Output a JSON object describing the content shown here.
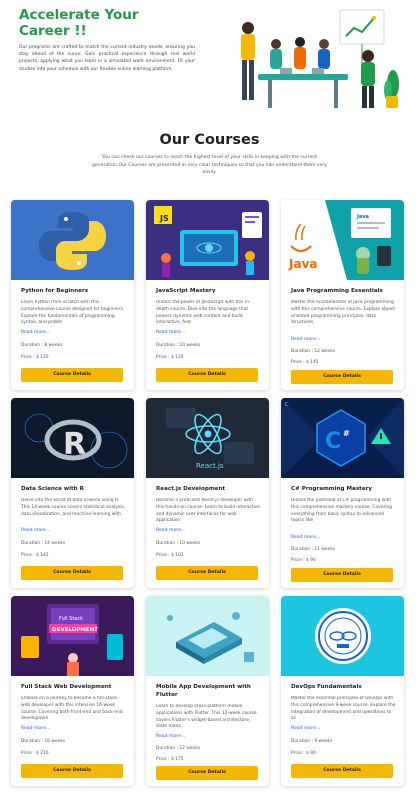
{
  "hero": {
    "title": "Accelerate Your Career !!",
    "text": "Our programs are crafted to match the current industry needs, ensuring you stay ahead of the curve. Gain practical experience through real world projects, applying what you learn in a simulated work environment. Fit your studies into your schedule with our flexible online learning platform."
  },
  "courses_section": {
    "title": "Our Courses",
    "subtitle": "You can check our courses to reach the highest level of your skills in keeping with the current generation.Our Courses are presented in very clear techniques so that you can understand them very easily."
  },
  "cards": [
    {
      "image_icon": "python-logo-icon",
      "title": "Python for Beginners",
      "description": "Learn Python from scratch with this comprehensive course designed for beginners. Explore the fundamentals of programming, syntax, and proble",
      "read_more": "Read more...",
      "duration": "Duration : 8 weeks",
      "price": "Price : $ 120",
      "button": "Course Details",
      "image_color": "#3a73c8"
    },
    {
      "image_icon": "javascript-illustration-icon",
      "title": "JavaScript Mastery",
      "description": "Unlock the power of JavaScript with this in-depth course. Dive into the language that powers dynamic web content and build interactive, feat",
      "read_more": "Read more...",
      "duration": "Duration : 10 weeks",
      "price": "Price : $ 120",
      "button": "Course Details",
      "image_color": "#3c2f82"
    },
    {
      "image_icon": "java-logo-icon",
      "title": "Java Programming Essentials",
      "description": "Master the fundamentals of Java programming with this comprehensive course. Explore object-oriented programming principles, data structures,",
      "read_more": "Read more...",
      "duration": "Duration : 12 weeks",
      "price": "Price : $ 145",
      "button": "Course Details",
      "image_color": "#0fa3a9"
    },
    {
      "image_icon": "r-logo-icon",
      "title": "Data Science with R",
      "description": "Delve into the world of data science using R. This 14-week course covers statistical analysis, data visualization, and machine learning with",
      "read_more": "Read more...",
      "duration": "Duration : 14 weeks",
      "price": "Price : $ 142",
      "button": "Course Details",
      "image_color": "#0c1a2c"
    },
    {
      "image_icon": "react-logo-icon",
      "title": "React.js Development",
      "description": "Become a proficient React.js developer with this hands-on course. Learn to build interactive and dynamic user interfaces for web application",
      "read_more": "Read more...",
      "duration": "Duration : 10 weeks",
      "price": "Price : $ 102",
      "button": "Course Details",
      "image_color": "#1f2a38"
    },
    {
      "image_icon": "csharp-logo-icon",
      "title": "C# Programming Mastery",
      "description": "Unlock the potential of C# programming with this comprehensive mastery course. Covering everything from basic syntax to advanced topics like",
      "read_more": "Read more...",
      "duration": "Duration : 11 weeks",
      "price": "Price : $ 90",
      "button": "Course Details",
      "image_color": "#0a1e4a"
    },
    {
      "image_icon": "fullstack-illustration-icon",
      "title": "Full Stack Web Development",
      "description": "Embark on a journey to become a full-stack web developer with this intensive 16-week course. Covering both front-end and back-end developmen",
      "read_more": "Read more...",
      "duration": "Duration : 16 weeks",
      "price": "Price : $ 210",
      "button": "Course Details",
      "image_color": "#3b1a5c"
    },
    {
      "image_icon": "mobile-app-illustration-icon",
      "title": "Mobile App Development with Flutter",
      "description": "Learn to develop cross-platform mobile applications with Flutter. This 12-week course covers Flutter's widget-based architecture, state mana",
      "read_more": "Read more...",
      "duration": "Duration : 12 weeks",
      "price": "Price : $ 175",
      "button": "Course Details",
      "image_color": "#c9f3f3"
    },
    {
      "image_icon": "devops-badge-icon",
      "title": "DevOps Fundamentals",
      "description": "Master the essential principles of DevOps with this comprehensive 9-week course. Explore the integration of development and operations to ac",
      "read_more": "Read more...",
      "duration": "Duration : 9 weeks",
      "price": "Price : $ 90",
      "button": "Course Details",
      "image_color": "#1cc6e3"
    }
  ]
}
